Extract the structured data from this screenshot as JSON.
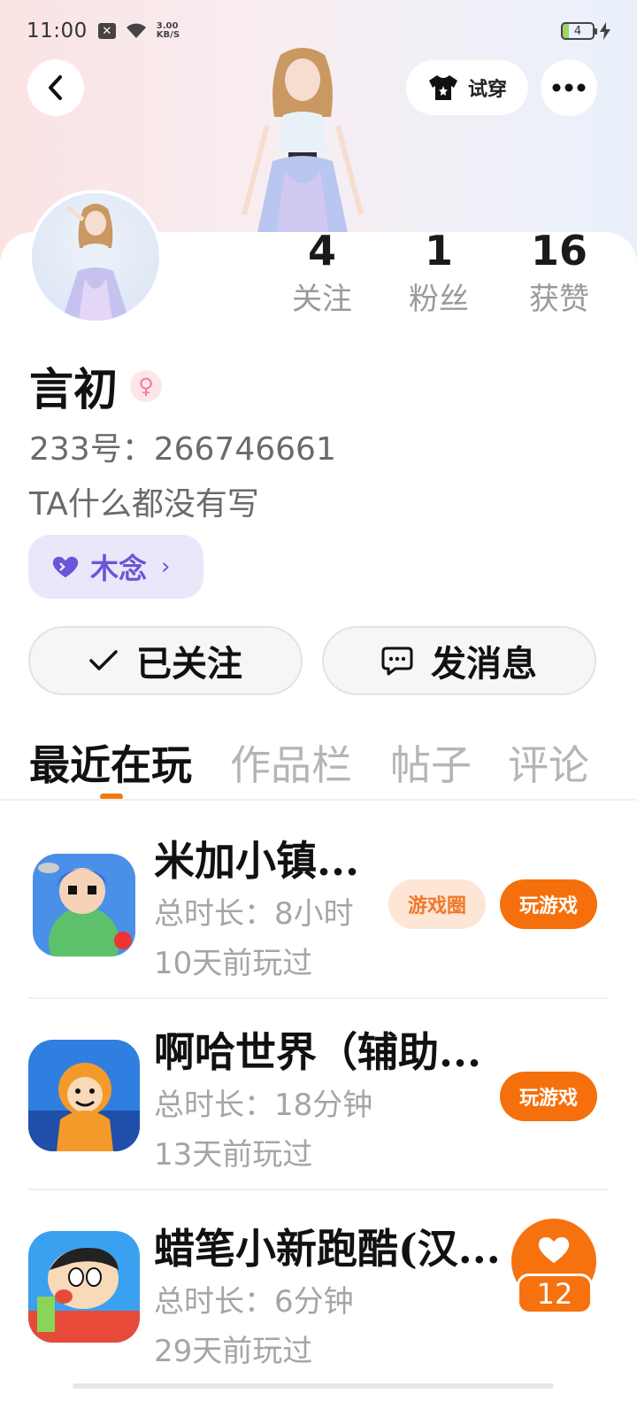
{
  "status_bar": {
    "time": "11:00",
    "net_speed_value": "3.00",
    "net_speed_unit": "KB/S",
    "battery": "4",
    "icons": [
      "notification-x-icon",
      "wifi-icon",
      "battery-icon",
      "charging-icon"
    ]
  },
  "header": {
    "back_icon": "chevron-left-icon",
    "try_on_label": "试穿",
    "try_on_icon": "shirt-icon",
    "more_icon": "more-dots-icon"
  },
  "profile": {
    "stats": [
      {
        "value": "4",
        "label": "关注"
      },
      {
        "value": "1",
        "label": "粉丝"
      },
      {
        "value": "16",
        "label": "获赞"
      }
    ],
    "name": "言初",
    "gender_icon": "female-icon",
    "uid": "233号：266746661",
    "bio": "TA什么都没有写",
    "guild": {
      "label": "木念",
      "icon": "heart-icon",
      "chevron": "›"
    },
    "follow_button": "已关注",
    "message_button": "发消息"
  },
  "tabs": [
    "最近在玩",
    "作品栏",
    "帖子",
    "评论"
  ],
  "active_tab": 0,
  "games": [
    {
      "title": "米加小镇...",
      "duration": "总时长：8小时",
      "last_played": "10天前玩过",
      "circle_button": "游戏圈",
      "play_button": "玩游戏"
    },
    {
      "title": "啊哈世界（辅助...",
      "duration": "总时长：18分钟",
      "last_played": "13天前玩过",
      "play_button": "玩游戏"
    },
    {
      "title": "蜡笔小新跑酷(汉...",
      "duration": "总时长：6分钟",
      "last_played": "29天前玩过"
    }
  ],
  "like_fab": {
    "count": "12",
    "icon": "heart-icon"
  },
  "colors": {
    "accent": "#f5700d",
    "guild_bg": "#ebe7fb",
    "guild_text": "#6c55d6",
    "muted_text": "#a5a5a5"
  }
}
